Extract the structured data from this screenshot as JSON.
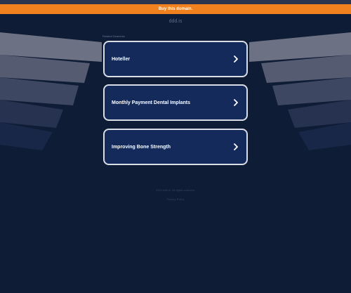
{
  "banner": {
    "label": "Buy this domain."
  },
  "header": {
    "domain": "ddd.is"
  },
  "related": {
    "heading": "Related Searches",
    "items": [
      {
        "label": "Hoteller"
      },
      {
        "label": "Monthly Payment Dental Implants"
      },
      {
        "label": "Improving Bone Strength"
      }
    ]
  },
  "footer": {
    "copyright": "2024 ddd.is. All rights reserved.",
    "privacy": "Privacy Policy"
  },
  "colors": {
    "background": "#0f1c36",
    "banner": "#f0811e",
    "card": "#132a5a",
    "card_border": "#d9dde6"
  },
  "icons": {
    "link_arrow": "chevron-right-icon"
  }
}
